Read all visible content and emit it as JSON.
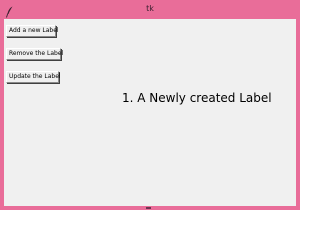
{
  "window": {
    "title": "tk",
    "icon": "feather-icon",
    "frame_color": "#e96d99",
    "client_color": "#f0f0f0"
  },
  "buttons": {
    "add_label": "Add a new Label",
    "remove_label": "Remove the Label",
    "update_label": "Update the Label"
  },
  "labels": [
    {
      "text": "1. A Newly created Label"
    }
  ]
}
